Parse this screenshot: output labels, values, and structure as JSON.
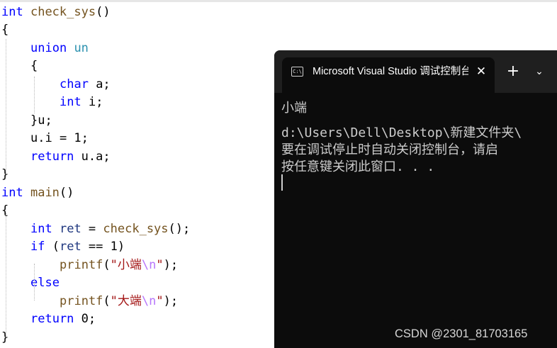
{
  "editor": {
    "lines": [
      [
        {
          "t": "int",
          "c": "kw"
        },
        {
          "t": " "
        },
        {
          "t": "check_sys",
          "c": "fn"
        },
        {
          "t": "()"
        }
      ],
      [
        {
          "t": "{"
        }
      ],
      [
        {
          "t": "union",
          "c": "kw"
        },
        {
          "t": " "
        },
        {
          "t": "un",
          "c": "ty"
        }
      ],
      [
        {
          "t": "{"
        }
      ],
      [
        {
          "t": "char",
          "c": "kw"
        },
        {
          "t": " a;"
        }
      ],
      [
        {
          "t": "int",
          "c": "kw"
        },
        {
          "t": " i;"
        }
      ],
      [
        {
          "t": "}u;"
        }
      ],
      [
        {
          "t": "u.i = 1;"
        }
      ],
      [
        {
          "t": "return",
          "c": "kw"
        },
        {
          "t": " u.a;"
        }
      ],
      [
        {
          "t": "}"
        }
      ],
      [
        {
          "t": "int",
          "c": "kw"
        },
        {
          "t": " "
        },
        {
          "t": "main",
          "c": "fn"
        },
        {
          "t": "()"
        }
      ],
      [
        {
          "t": "{"
        }
      ],
      [
        {
          "t": "int",
          "c": "kw"
        },
        {
          "t": " "
        },
        {
          "t": "ret",
          "c": "var"
        },
        {
          "t": " = "
        },
        {
          "t": "check_sys",
          "c": "fn"
        },
        {
          "t": "();"
        }
      ],
      [
        {
          "t": "if",
          "c": "kw"
        },
        {
          "t": " ("
        },
        {
          "t": "ret",
          "c": "var"
        },
        {
          "t": " == 1)"
        }
      ],
      [
        {
          "t": "printf",
          "c": "fn"
        },
        {
          "t": "("
        },
        {
          "t": "\"小端",
          "c": "str"
        },
        {
          "t": "\\n",
          "c": "esc"
        },
        {
          "t": "\"",
          "c": "str"
        },
        {
          "t": ");"
        }
      ],
      [
        {
          "t": "else",
          "c": "kw"
        }
      ],
      [
        {
          "t": "printf",
          "c": "fn"
        },
        {
          "t": "("
        },
        {
          "t": "\"大端",
          "c": "str"
        },
        {
          "t": "\\n",
          "c": "esc"
        },
        {
          "t": "\"",
          "c": "str"
        },
        {
          "t": ");"
        }
      ],
      [
        {
          "t": "return",
          "c": "kw"
        },
        {
          "t": " 0;"
        }
      ],
      [
        {
          "t": "}"
        }
      ]
    ]
  },
  "console": {
    "tab_icon_text": "C:\\",
    "tab_title": "Microsoft Visual Studio 调试控制台",
    "tab_close": "✕",
    "new_tab": "+",
    "dropdown": "⌄",
    "output": [
      "小端",
      "",
      "d:\\Users\\Dell\\Desktop\\新建文件夹\\",
      "要在调试停止时自动关闭控制台，请启",
      "按任意键关闭此窗口. . ."
    ]
  },
  "watermark": "CSDN @2301_81703165",
  "colors": {
    "keyword": "#0000ff",
    "function": "#74531f",
    "variable": "#1f377f",
    "type": "#2b91af",
    "string": "#a31515",
    "escape": "#b776fb",
    "console_bg": "#0c0c0c",
    "tabbar_bg": "#1f1f1f",
    "console_text": "#cccccc"
  }
}
